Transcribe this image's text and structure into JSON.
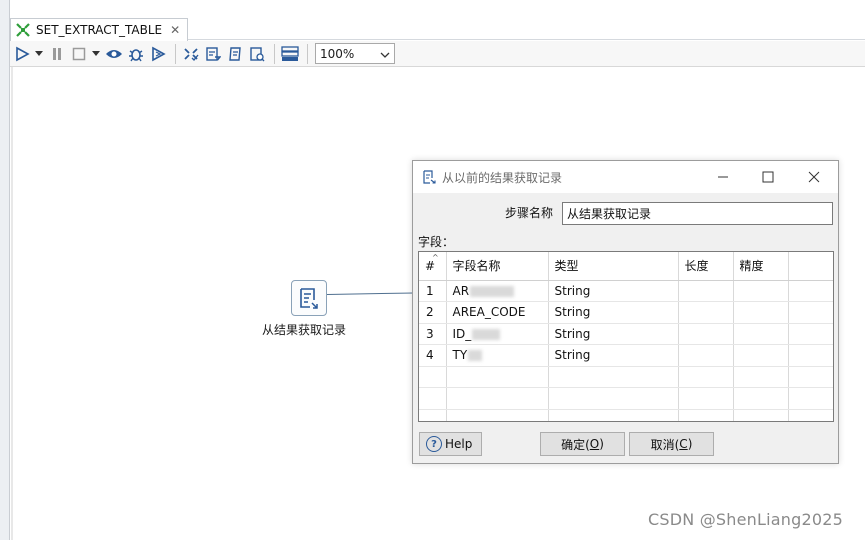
{
  "tab": {
    "title": "SET_EXTRACT_TABLE",
    "close_glyph": "✕"
  },
  "toolbar": {
    "zoom_value": "100%",
    "icons": [
      "run-icon",
      "run-dropdown-icon",
      "pause-icon",
      "stop-icon",
      "stop-dropdown-icon",
      "preview-icon",
      "debug-icon",
      "replay-icon",
      "verify-icon",
      "impact-icon",
      "sql-icon",
      "explore-db-icon",
      "show-results-icon"
    ]
  },
  "canvas": {
    "step_label": "从结果获取记录",
    "watermark": "CSDN @ShenLiang2025"
  },
  "dialog": {
    "title": "从以前的结果获取记录",
    "step_name_label": "步骤名称",
    "step_name_value": "从结果获取记录",
    "fields_label": "字段：",
    "columns": [
      "#",
      "字段名称",
      "类型",
      "长度",
      "精度"
    ],
    "rows": [
      {
        "num": "1",
        "name": "AR",
        "type": "String"
      },
      {
        "num": "2",
        "name": "AREA_CODE",
        "type": "String"
      },
      {
        "num": "3",
        "name": "ID_",
        "type": "String"
      },
      {
        "num": "4",
        "name": "TY",
        "type": "String"
      }
    ],
    "help_label": "Help",
    "ok_label": "确定(",
    "ok_mnemonic": "O",
    "ok_suffix": ")",
    "cancel_label": "取消(",
    "cancel_mnemonic": "C",
    "cancel_suffix": ")"
  },
  "colors": {
    "accent": "#2a5a9a",
    "tab_icon": "#2e9e3a",
    "hop": "#4f6f8f"
  }
}
